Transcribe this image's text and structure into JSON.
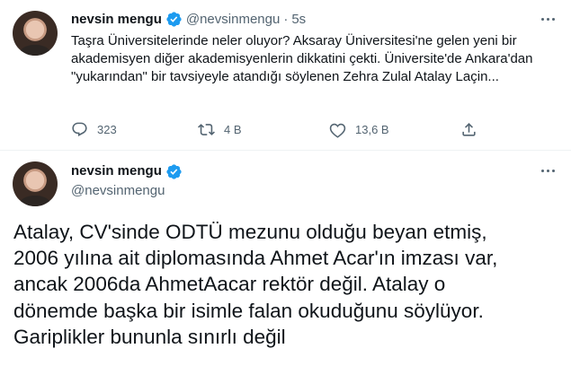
{
  "tweet1": {
    "display_name": "nevsin mengu",
    "handle": "@nevsinmengu",
    "separator": "·",
    "time": "5s",
    "text": "Taşra Üniversitelerinde neler oluyor? Aksaray Üniversitesi'ne gelen yeni bir akademisyen diğer akademisyenlerin dikkatini çekti. Üniversite'de Ankara'dan \"yukarından\" bir tavsiyeyle atandığı söylenen Zehra Zulal Atalay Laçin...",
    "reply_count": "323",
    "retweet_count": "4 B",
    "like_count": "13,6 B"
  },
  "tweet2": {
    "display_name": "nevsin mengu",
    "handle": "@nevsinmengu",
    "text": "Atalay, CV'sinde ODTÜ mezunu olduğu beyan etmiş,\n2006 yılına ait diplomasında Ahmet Acar'ın imzası var,\nancak 2006da AhmetAacar rektör değil. Atalay o\ndönemde başka bir isimle falan okuduğunu söylüyor.\nGariplikler bununla sınırlı değil"
  },
  "icons": {
    "verified": "verified-badge-icon",
    "more": "more-icon",
    "reply": "reply-icon",
    "retweet": "retweet-icon",
    "like": "heart-icon",
    "share": "share-icon"
  },
  "colors": {
    "verified_blue": "#1d9bf0",
    "text_primary": "#0f1419",
    "text_secondary": "#536471",
    "divider": "#eff3f4"
  }
}
